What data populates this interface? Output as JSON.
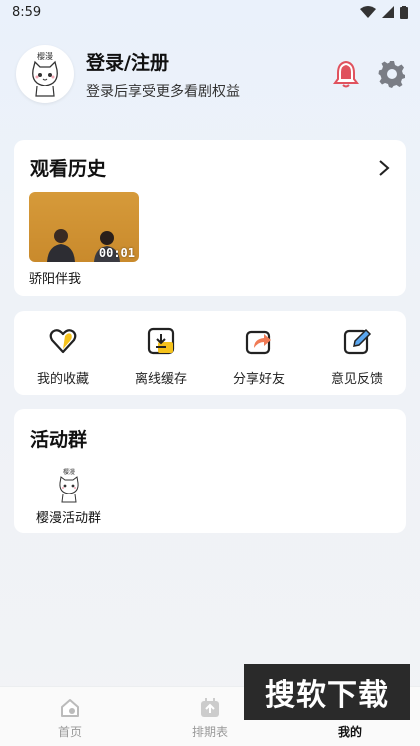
{
  "status_bar": {
    "time": "8:59"
  },
  "header": {
    "login_title": "登录/注册",
    "login_subtitle": "登录后享受更多看剧权益",
    "avatar_text": "樱漫"
  },
  "history": {
    "title": "观看历史",
    "items": [
      {
        "title": "骄阳伴我",
        "duration": "00:01"
      }
    ]
  },
  "actions": [
    {
      "label": "我的收藏",
      "icon": "heart-icon"
    },
    {
      "label": "离线缓存",
      "icon": "download-icon"
    },
    {
      "label": "分享好友",
      "icon": "share-icon"
    },
    {
      "label": "意见反馈",
      "icon": "edit-icon"
    }
  ],
  "group": {
    "title": "活动群",
    "items": [
      {
        "label": "樱漫活动群",
        "icon_text": "樱漫"
      }
    ]
  },
  "bottom_nav": [
    {
      "label": "首页",
      "active": false
    },
    {
      "label": "排期表",
      "active": false
    },
    {
      "label": "我的",
      "active": true
    }
  ],
  "watermark": {
    "text": "搜软下载"
  },
  "colors": {
    "accent_yellow": "#f5c21b",
    "bell_red": "#e0525e",
    "gear_gray": "#7a7d85"
  }
}
